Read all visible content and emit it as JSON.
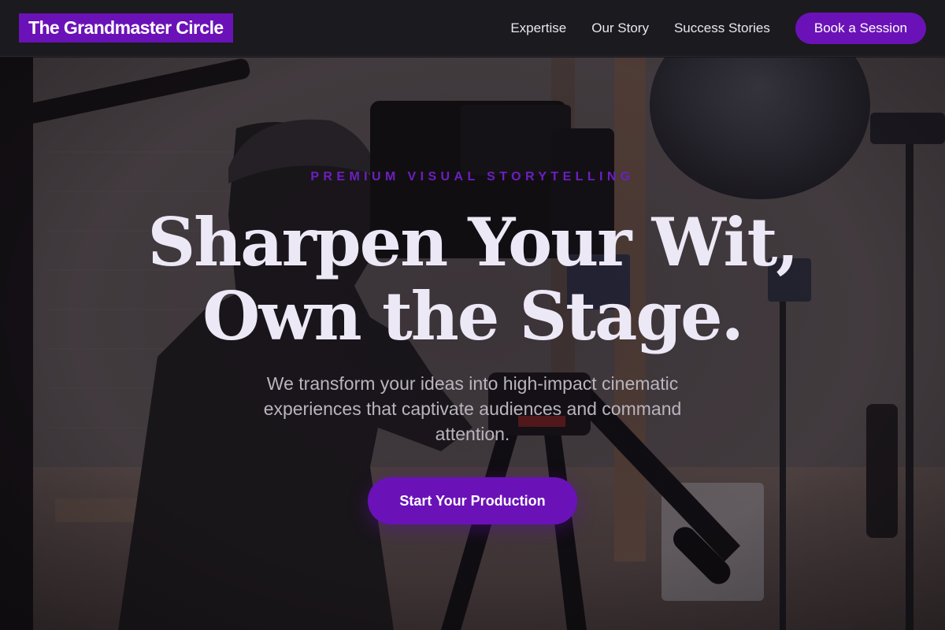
{
  "header": {
    "logo": "The Grandmaster Circle",
    "nav": [
      "Expertise",
      "Our Story",
      "Success Stories"
    ],
    "cta": "Book a Session"
  },
  "hero": {
    "eyebrow": "PREMIUM VISUAL STORYTELLING",
    "headline_line1": "Sharpen Your Wit,",
    "headline_line2": "Own the Stage.",
    "subtext": "We transform your ideas into high-impact cinematic experiences that captivate audiences and command attention.",
    "cta": "Start Your Production"
  },
  "colors": {
    "accent": "#6a12b8",
    "header_bg": "#1b1a1e",
    "headline": "#ece8f6",
    "body_text": "#b9b4be"
  }
}
